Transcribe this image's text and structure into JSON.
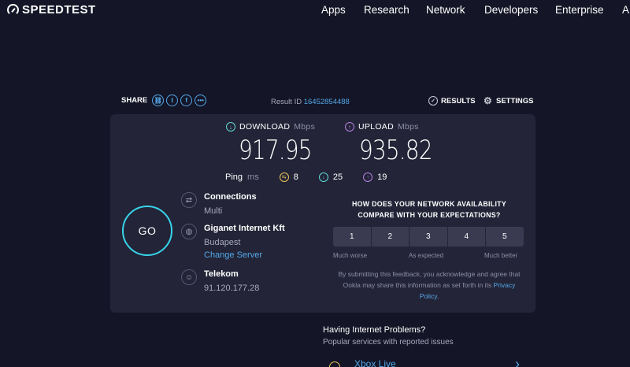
{
  "brand": {
    "name": "SPEEDTEST"
  },
  "nav": {
    "items": [
      "Apps",
      "Research",
      "Network",
      "Developers",
      "Enterprise",
      "A"
    ]
  },
  "share": {
    "label": "SHARE",
    "icons": [
      "link-icon",
      "twitter-icon",
      "facebook-icon",
      "more-icon"
    ]
  },
  "result": {
    "label": "Result ID",
    "id": "16452854488"
  },
  "actions": {
    "results": "RESULTS",
    "settings": "SETTINGS"
  },
  "download": {
    "label": "DOWNLOAD",
    "unit": "Mbps",
    "value": "917.95",
    "color": "#5ed8d6"
  },
  "upload": {
    "label": "UPLOAD",
    "unit": "Mbps",
    "value": "935.82",
    "color": "#b57fe0"
  },
  "ping": {
    "label": "Ping",
    "unit": "ms",
    "idle": "8",
    "download": "25",
    "upload": "19"
  },
  "go": {
    "label": "GO",
    "color": "#38d3ea"
  },
  "connections": {
    "title": "Connections",
    "value": "Multi"
  },
  "isp": {
    "title": "Giganet Internet Kft",
    "location": "Budapest",
    "change": "Change Server"
  },
  "host": {
    "title": "Telekom",
    "ip": "91.120.177.28"
  },
  "feedback": {
    "question_line1": "HOW DOES YOUR NETWORK AVAILABILITY",
    "question_line2": "COMPARE WITH YOUR EXPECTATIONS?",
    "options": [
      "1",
      "2",
      "3",
      "4",
      "5"
    ],
    "low": "Much worse",
    "mid": "As expected",
    "high": "Much better",
    "disclaimer": "By submitting this feedback, you acknowledge and agree that Ookla may share this information as set forth in its",
    "privacy": "Privacy Policy",
    "period": "."
  },
  "problems": {
    "title": "Having Internet Problems?",
    "subtitle": "Popular services with reported issues",
    "first_service": "Xbox Live"
  }
}
